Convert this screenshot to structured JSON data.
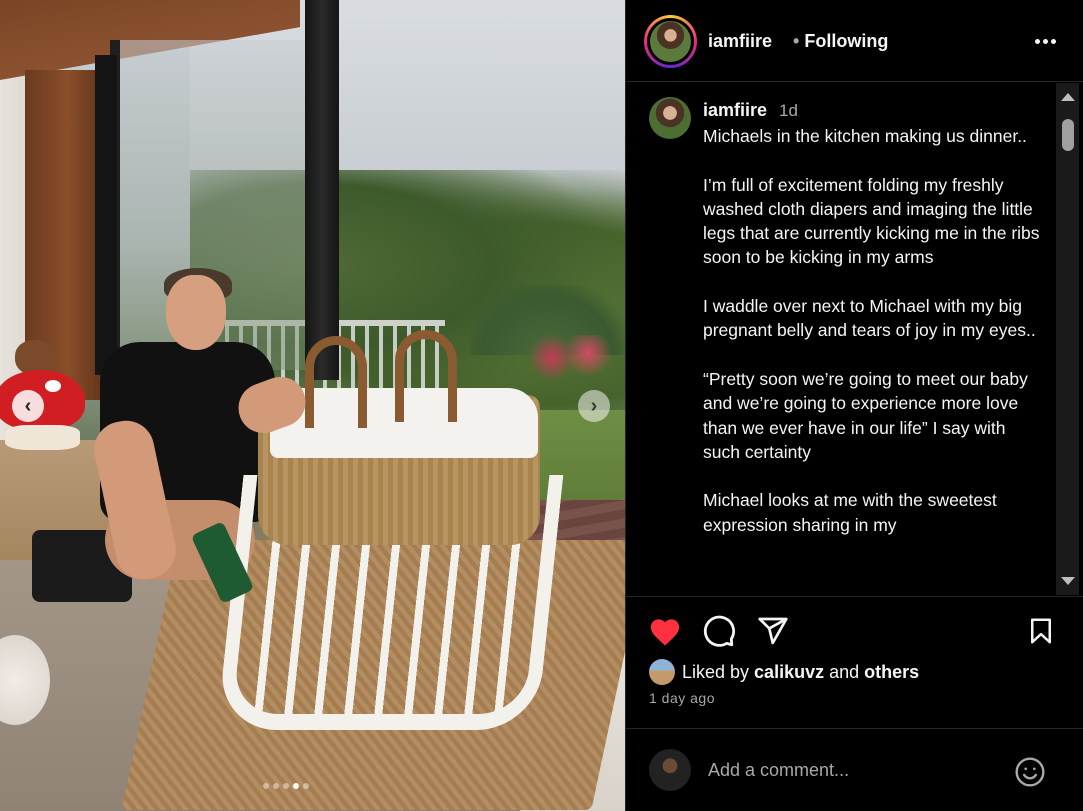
{
  "post": {
    "username": "iamfiire",
    "separator": "•",
    "follow_status": "Following",
    "carousel": {
      "prev_glyph": "‹",
      "next_glyph": "›",
      "slide_count": 5,
      "active_index": 3
    }
  },
  "caption": {
    "username": "iamfiire",
    "time": "1d",
    "text": "Michaels in the kitchen making us dinner..\n\nI’m full of excitement folding my freshly washed cloth diapers and imaging the little legs that are currently kicking me in the ribs soon to be kicking in my arms\n\nI waddle over next to Michael with my big pregnant belly and tears of joy in my eyes..\n\n“Pretty soon we’re going to meet our baby and we’re going to experience more love than we ever have in our life” I say with such certainty\n\nMichael looks at me with the sweetest expression sharing in my"
  },
  "actions": {
    "liked": true,
    "like_color": "#ff3040",
    "icons": [
      "heart-icon",
      "comment-icon",
      "share-icon",
      "bookmark-icon"
    ]
  },
  "likes": {
    "prefix": "Liked by ",
    "user": "calikuvz",
    "middle": " and ",
    "suffix": "others"
  },
  "timestamp": "1 day ago",
  "comment": {
    "placeholder": "Add a comment..."
  }
}
